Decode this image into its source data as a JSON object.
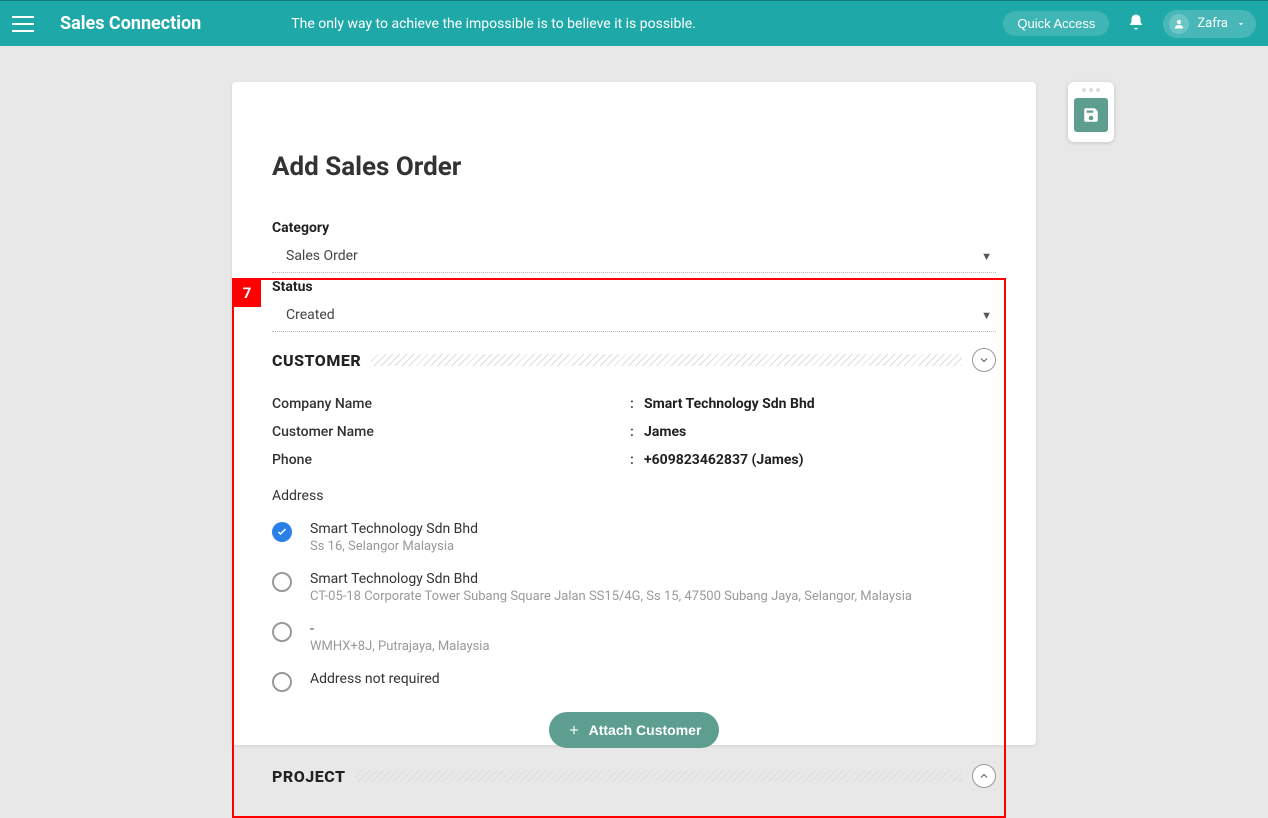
{
  "header": {
    "brand": "Sales Connection",
    "tagline": "The only way to achieve the impossible is to believe it is possible.",
    "quick_access": "Quick Access",
    "user_name": "Zafra"
  },
  "page": {
    "title": "Add Sales Order",
    "step_number": "7"
  },
  "fields": {
    "category_label": "Category",
    "category_value": "Sales Order",
    "status_label": "Status",
    "status_value": "Created"
  },
  "sections": {
    "customer": "CUSTOMER",
    "project": "PROJECT"
  },
  "customer": {
    "company_label": "Company Name",
    "company_value": "Smart Technology Sdn Bhd",
    "name_label": "Customer Name",
    "name_value": "James",
    "phone_label": "Phone",
    "phone_value": "+609823462837 (James)",
    "address_label": "Address",
    "addresses": [
      {
        "title": "Smart Technology Sdn Bhd",
        "sub": "Ss 16, Selangor Malaysia",
        "selected": true
      },
      {
        "title": "Smart Technology Sdn Bhd",
        "sub": "CT-05-18 Corporate Tower Subang Square Jalan SS15/4G, Ss 15, 47500 Subang Jaya, Selangor, Malaysia",
        "selected": false
      },
      {
        "title": "-",
        "sub": "WMHX+8J, Putrajaya, Malaysia",
        "selected": false
      },
      {
        "title": "Address not required",
        "sub": "",
        "selected": false
      }
    ],
    "attach_label": "Attach Customer"
  }
}
